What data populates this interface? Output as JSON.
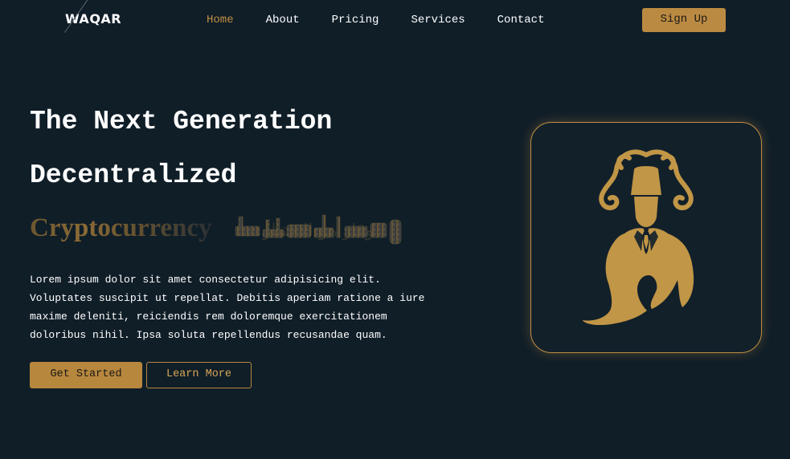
{
  "header": {
    "logo": "WAQAR",
    "nav": [
      {
        "label": "Home",
        "active": true
      },
      {
        "label": "About",
        "active": false
      },
      {
        "label": "Pricing",
        "active": false
      },
      {
        "label": "Services",
        "active": false
      },
      {
        "label": "Contact",
        "active": false
      }
    ],
    "signup_label": "Sign Up"
  },
  "hero": {
    "title_line1": "The Next Generation",
    "title_line2": "Decentralized",
    "title_line3": "Cryptocurrency",
    "arabic_logo_text": "وقار هو الاختيار",
    "description": "Lorem ipsum dolor sit amet consectetur adipisicing elit. Voluptates suscipit ut repellat. Debitis aperiam ratione a iure maxime deleniti, reiciendis rem doloremque exercitationem doloribus nihil. Ipsa soluta repellendus recusandae quam.",
    "primary_button": "Get Started",
    "secondary_button": "Learn More"
  },
  "colors": {
    "background": "#101e28",
    "accent": "#bb8a42",
    "active_nav": "#c08d42"
  },
  "icons": {
    "card_image": "gentleman-logo-icon"
  }
}
